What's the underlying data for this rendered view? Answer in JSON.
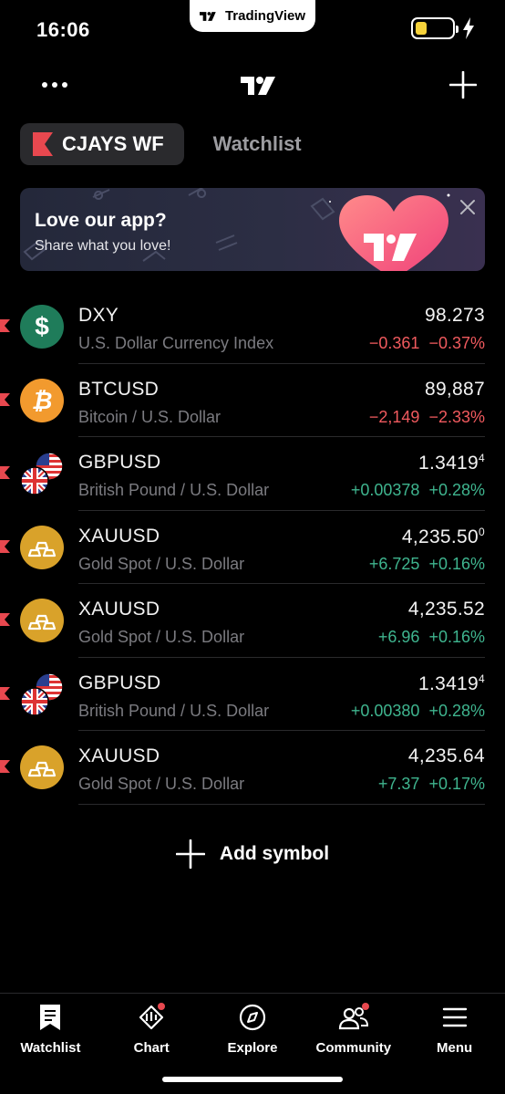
{
  "status_bar": {
    "time": "16:06",
    "app_pill": "TradingView"
  },
  "tabs": {
    "active": "CJAYS WF",
    "inactive": "Watchlist"
  },
  "banner": {
    "title": "Love our app?",
    "subtitle": "Share what you love!"
  },
  "symbols": [
    {
      "name": "DXY",
      "desc": "U.S. Dollar Currency Index",
      "price": "98.273",
      "price_sup": "",
      "change": "−0.361",
      "change_pct": "−0.37%",
      "direction": "neg",
      "icon": "dollar-icon"
    },
    {
      "name": "BTCUSD",
      "desc": "Bitcoin / U.S. Dollar",
      "price": "89,887",
      "price_sup": "",
      "change": "−2,149",
      "change_pct": "−2.33%",
      "direction": "neg",
      "icon": "bitcoin-icon"
    },
    {
      "name": "GBPUSD",
      "desc": "British Pound / U.S. Dollar",
      "price": "1.3419",
      "price_sup": "4",
      "change": "+0.00378",
      "change_pct": "+0.28%",
      "direction": "pos",
      "icon": "uk-us-flags-icon"
    },
    {
      "name": "XAUUSD",
      "desc": "Gold Spot / U.S. Dollar",
      "price": "4,235.50",
      "price_sup": "0",
      "change": "+6.725",
      "change_pct": "+0.16%",
      "direction": "pos",
      "icon": "gold-bars-icon"
    },
    {
      "name": "XAUUSD",
      "desc": "Gold Spot / U.S. Dollar",
      "price": "4,235.52",
      "price_sup": "",
      "change": "+6.96",
      "change_pct": "+0.16%",
      "direction": "pos",
      "icon": "gold-bars-icon"
    },
    {
      "name": "GBPUSD",
      "desc": "British Pound / U.S. Dollar",
      "price": "1.3419",
      "price_sup": "4",
      "change": "+0.00380",
      "change_pct": "+0.28%",
      "direction": "pos",
      "icon": "uk-us-flags-icon"
    },
    {
      "name": "XAUUSD",
      "desc": "Gold Spot / U.S. Dollar",
      "price": "4,235.64",
      "price_sup": "",
      "change": "+7.37",
      "change_pct": "+0.17%",
      "direction": "pos",
      "icon": "gold-bars-icon"
    }
  ],
  "add_symbol": "Add symbol",
  "nav": {
    "watchlist": "Watchlist",
    "chart": "Chart",
    "explore": "Explore",
    "community": "Community",
    "menu": "Menu"
  },
  "colors": {
    "negative": "#f05a5e",
    "positive": "#3fb58f",
    "flag_red": "#e8484f",
    "gold": "#d9a22a"
  }
}
